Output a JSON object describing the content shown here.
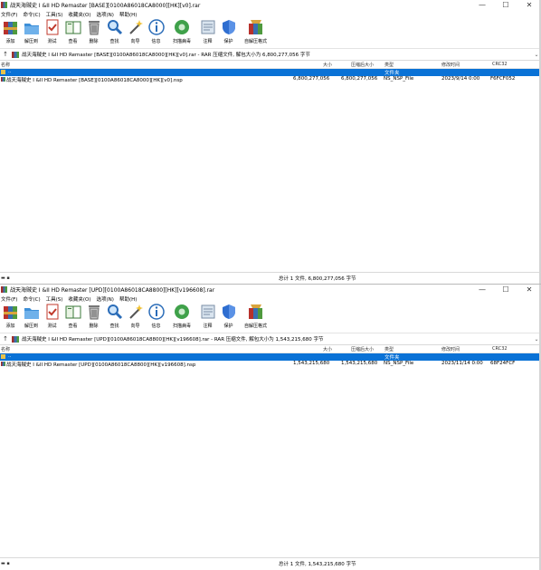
{
  "colors": {
    "accent": "#0a72d6",
    "toolbar_bg": "#ffffff"
  },
  "menu": [
    "文件(F)",
    "命令(C)",
    "工具(S)",
    "收藏夹(O)",
    "选项(N)",
    "帮助(H)"
  ],
  "toolbar": [
    {
      "label": "添加",
      "icon": "add-archive-icon"
    },
    {
      "label": "解压到",
      "icon": "extract-to-icon"
    },
    {
      "label": "测试",
      "icon": "test-icon"
    },
    {
      "label": "查看",
      "icon": "view-icon"
    },
    {
      "label": "删除",
      "icon": "delete-icon"
    },
    {
      "label": "查找",
      "icon": "find-icon"
    },
    {
      "label": "向导",
      "icon": "wizard-icon"
    },
    {
      "label": "信息",
      "icon": "info-icon"
    },
    {
      "label": "扫描病毒",
      "icon": "virus-scan-icon"
    },
    {
      "label": "注释",
      "icon": "comment-icon"
    },
    {
      "label": "保护",
      "icon": "protect-icon"
    },
    {
      "label": "自解压格式",
      "icon": "sfx-icon"
    }
  ],
  "columns": {
    "name": "名称",
    "size": "大小",
    "packed": "压缩后大小",
    "type": "类型",
    "modified": "修改时间",
    "crc": "CRC32"
  },
  "window_controls": {
    "min": "—",
    "max": "☐",
    "close": "✕"
  },
  "windows": [
    {
      "title": "战天海贼史 I &II HD Remaster [BASE][0100A86018CA8000][HK][v0].rar",
      "address": "战天海贼史 I &II HD Remaster [BASE][0100A86018CA8000][HK][v0].rar - RAR 压缩文件, 解包大小为 6,800,277,056 字节",
      "parent_row": {
        "name": "..",
        "type": "文件夹"
      },
      "file_row": {
        "name": "战天海贼史 I &II HD Remaster [BASE][0100A86018CA8000][HK][v0].nsp",
        "size": "6,800,277,056",
        "packed": "6,800,277,056",
        "type": "NS_NSP_File",
        "modified": "2023/9/14 0:00",
        "crc": "F6FCF052"
      },
      "status": "总计 1 文件, 6,800,277,056 字节"
    },
    {
      "title": "战天海贼史 I &II HD Remaster [UPD][0100A86018CA8800][HK][v196608].rar",
      "address": "战天海贼史 I &II HD Remaster [UPD][0100A86018CA8800][HK][v196608].rar - RAR 压缩文件, 解包大小为 1,543,215,680 字节",
      "parent_row": {
        "name": "..",
        "type": "文件夹"
      },
      "file_row": {
        "name": "战天海贼史 I &II HD Remaster [UPD][0100A86018CA8800][HK][v196608].nsp",
        "size": "1,543,215,680",
        "packed": "1,543,215,680",
        "type": "NS_NSP_File",
        "modified": "2023/11/14 0:00",
        "crc": "68F24FCF"
      },
      "status": "总计 1 文件, 1,543,215,680 字节"
    }
  ]
}
